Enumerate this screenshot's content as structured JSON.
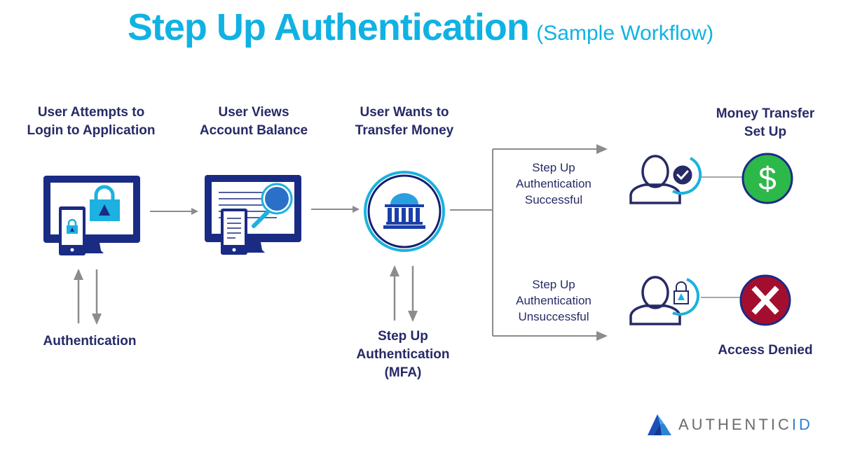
{
  "title": {
    "main": "Step Up Authentication",
    "sub": "(Sample Workflow)"
  },
  "steps": [
    {
      "id": "login",
      "label_line1": "User Attempts to",
      "label_line2": "Login to Application",
      "icon": "monitor-with-lock-icon"
    },
    {
      "id": "balance",
      "label_line1": "User Views",
      "label_line2": "Account Balance",
      "icon": "monitor-with-magnifier-icon"
    },
    {
      "id": "transfer",
      "label_line1": "User Wants to",
      "label_line2": "Transfer Money",
      "icon": "bank-icon"
    },
    {
      "id": "setup",
      "label_line1": "Money Transfer",
      "label_line2": "Set Up",
      "icon": "dollar-icon"
    }
  ],
  "sub_labels": {
    "authentication": "Authentication",
    "step_up_mfa": [
      "Step Up",
      "Authentication",
      "(MFA)"
    ]
  },
  "branches": {
    "success": [
      "Step Up",
      "Authentication",
      "Successful"
    ],
    "failure": [
      "Step Up",
      "Authentication",
      "Unsuccessful"
    ]
  },
  "outcomes": {
    "denied": "Access Denied"
  },
  "brand": {
    "name_main": "AUTHENTIC",
    "name_id": "ID"
  },
  "colors": {
    "title": "#10b2e3",
    "navy": "#1a2b84",
    "dark_text": "#262a66",
    "cyan": "#1cb1e0",
    "arrow_gray": "#8c8c8c",
    "success_green": "#2db84a",
    "denied_red": "#a40e2e"
  }
}
